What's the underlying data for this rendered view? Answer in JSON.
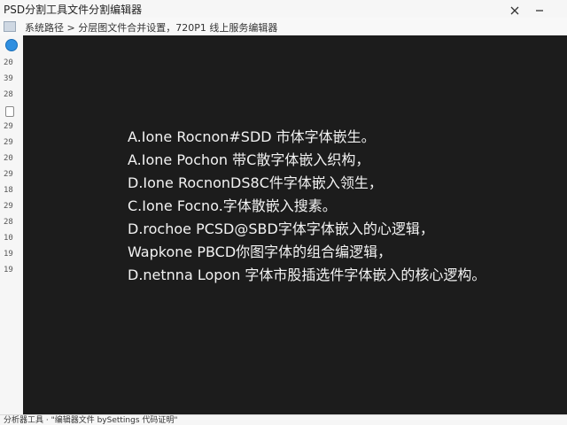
{
  "window": {
    "title": "PSD分割工具文件分割编辑器",
    "path": "系统路径 > 分层图文件合并设置，720P1 线上服务编辑器"
  },
  "gutter": {
    "line_numbers": [
      "20",
      "39",
      "28",
      "29",
      "29",
      "20",
      "29",
      "18",
      "29",
      "28",
      "10",
      "19",
      "19"
    ]
  },
  "editor": {
    "lines": [
      "A.Ione Rocnon#SDD 市体字体嵌生。",
      "A.Ione Pochon 带C散字体嵌入织构，",
      "D.Ione RocnonDS8C件字体嵌入领生，",
      "C.Ione Focno.字体散嵌入搜素。",
      "D.rochoe PCSD@SBD字体字体嵌入的心逻辑，",
      "Wapkone PBCD你图字体的组合编逻辑，",
      "D.netnna Lopon 字体市股插选件字体嵌入的核心逻构。"
    ]
  },
  "statusbar": {
    "text": "分析器工具 · \"编辑器文件 bySettings 代码证明\""
  },
  "colors": {
    "editor_bg": "#1c1c1c",
    "editor_text": "#f2f2f2",
    "accent": "#2f8fe0",
    "chrome_bg": "#f6f6f6"
  }
}
